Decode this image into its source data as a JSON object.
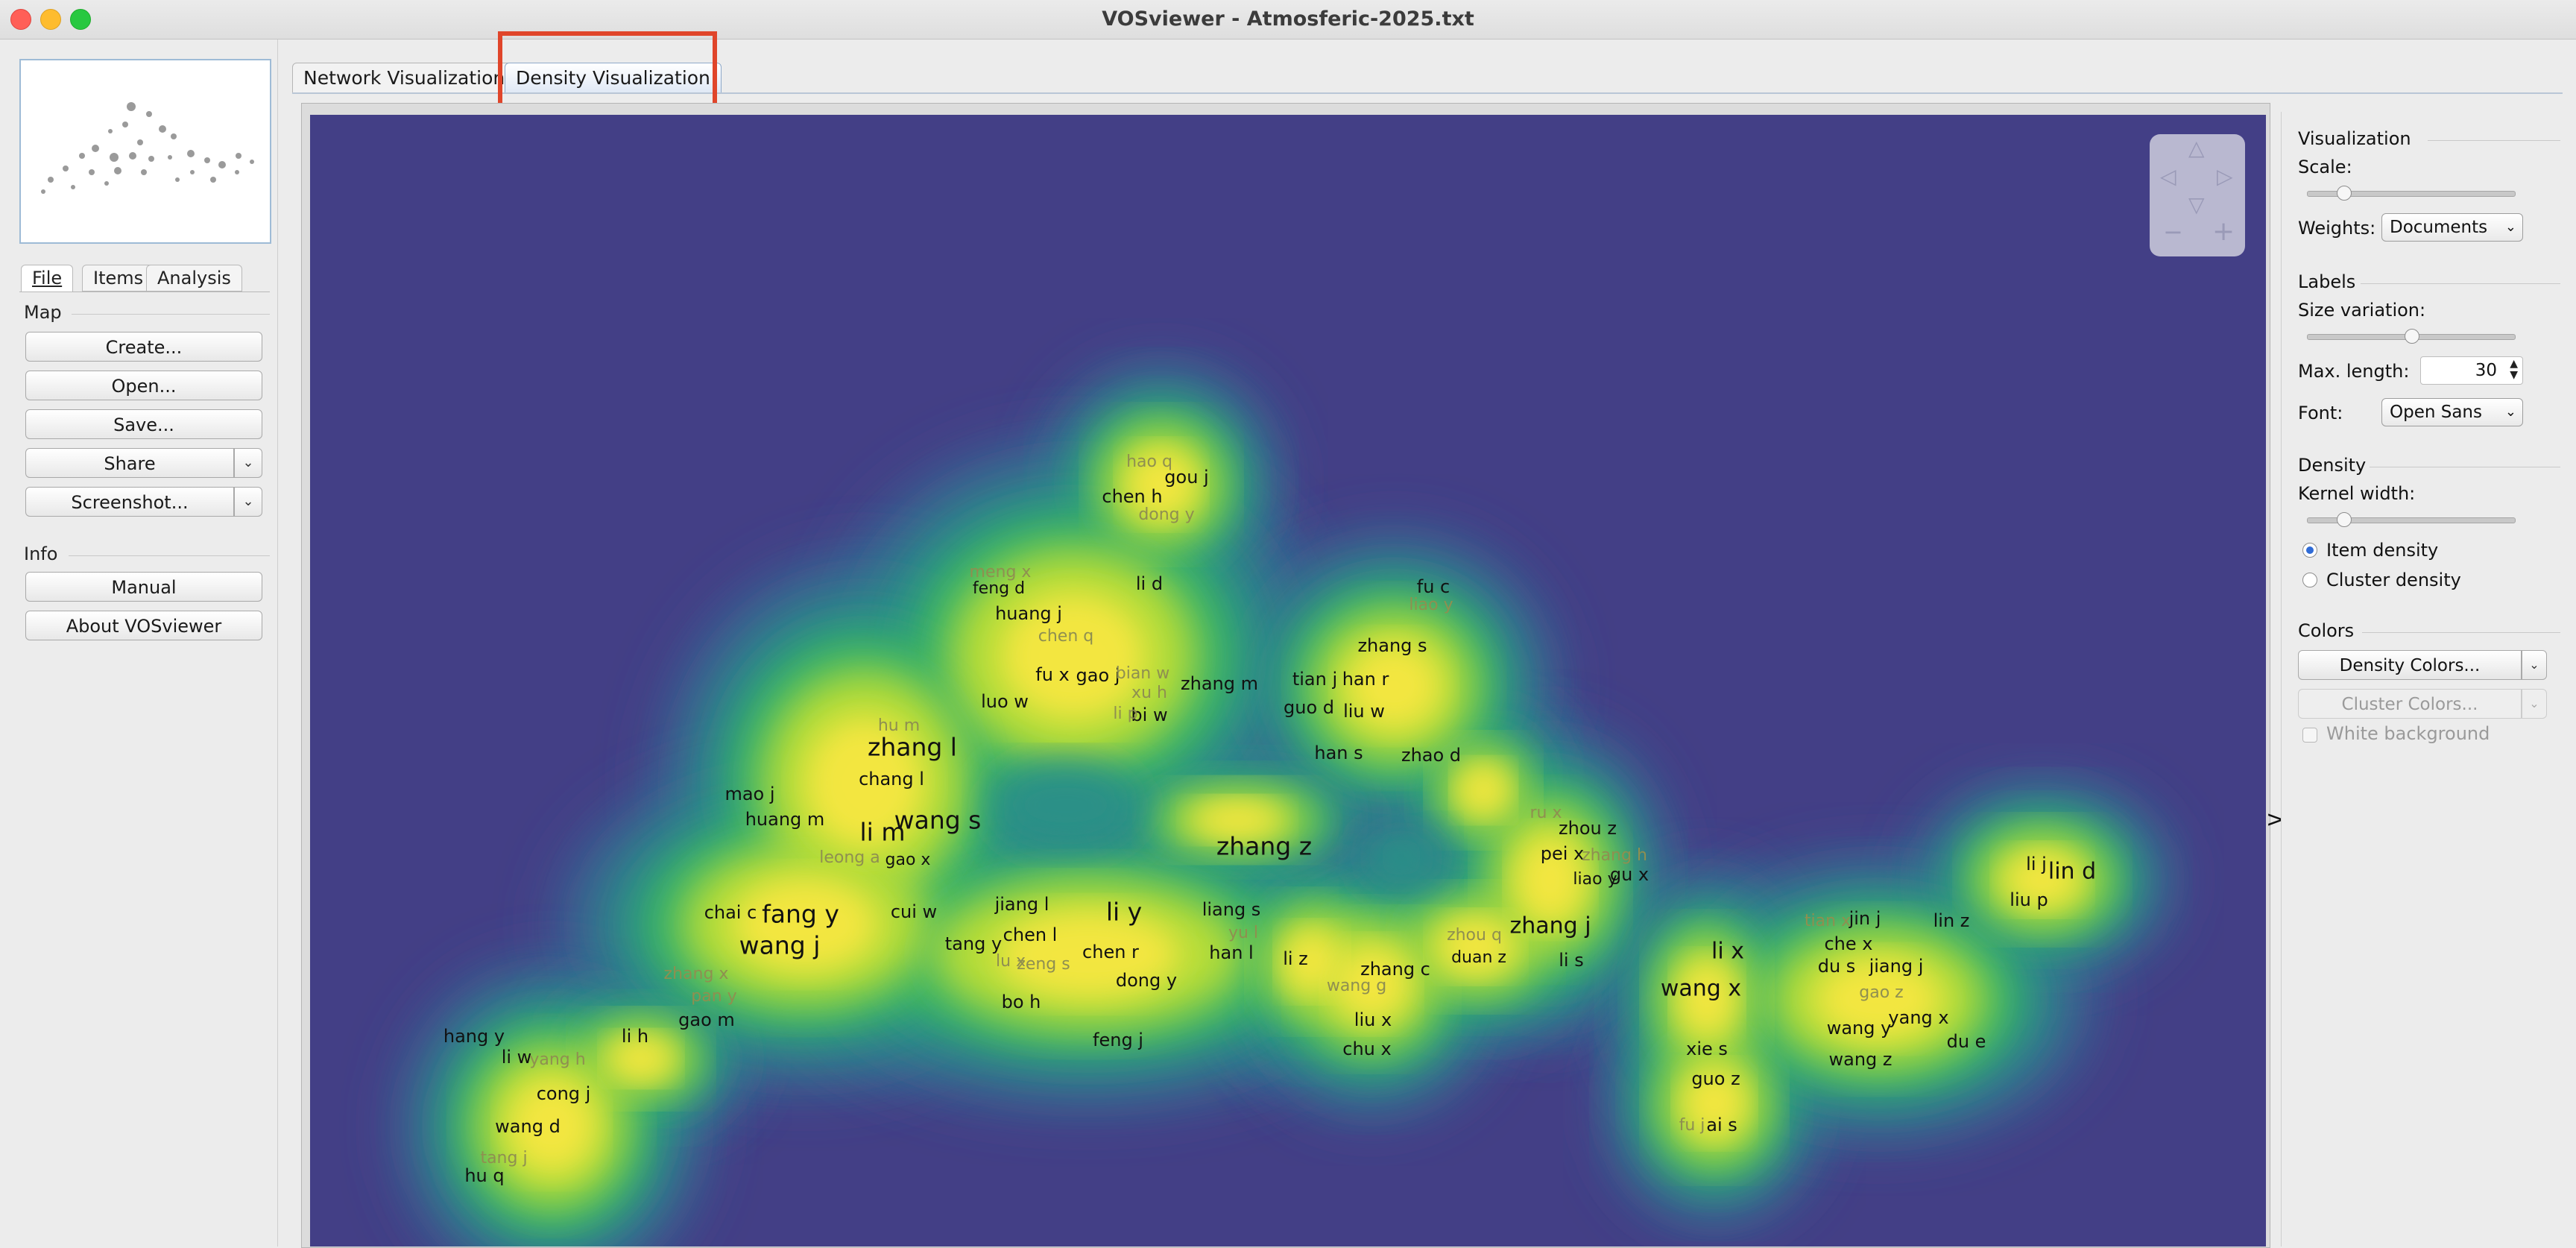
{
  "window": {
    "title": "VOSviewer - Atmosferic-2025.txt"
  },
  "left_panel": {
    "tabs": [
      "File",
      "Items",
      "Analysis"
    ],
    "map_section": "Map",
    "buttons": {
      "create": "Create...",
      "open": "Open...",
      "save": "Save...",
      "share": "Share",
      "screenshot": "Screenshot..."
    },
    "info_section": "Info",
    "info_buttons": {
      "manual": "Manual",
      "about": "About VOSviewer"
    }
  },
  "main_tabs": [
    "Network Visualization",
    "Density Visualization"
  ],
  "active_tab": "Density Visualization",
  "right_panel": {
    "visualization": {
      "header": "Visualization",
      "scale_label": "Scale:",
      "scale_value": 0.15,
      "weights_label": "Weights:",
      "weights_value": "Documents"
    },
    "labels": {
      "header": "Labels",
      "size_variation_label": "Size variation:",
      "size_variation_value": 0.5,
      "max_length_label": "Max. length:",
      "max_length_value": "30",
      "font_label": "Font:",
      "font_value": "Open Sans"
    },
    "density": {
      "header": "Density",
      "kernel_width_label": "Kernel width:",
      "kernel_width_value": 0.15,
      "item_density": "Item density",
      "cluster_density": "Cluster density",
      "selected": "Item density"
    },
    "colors": {
      "header": "Colors",
      "density_colors": "Density Colors...",
      "cluster_colors": "Cluster Colors...",
      "white_background": "White background"
    }
  },
  "density_map": {
    "colors": {
      "background": "#433f86",
      "blue": "#3a5f93",
      "teal": "#2a9087",
      "green": "#38b266",
      "lime": "#b6dd38",
      "yellow": "#f3e63f"
    },
    "items": [
      {
        "label": "hao q",
        "weight": 1,
        "faint": true
      },
      {
        "label": "gou j",
        "weight": 2
      },
      {
        "label": "chen h",
        "weight": 2
      },
      {
        "label": "dong y",
        "weight": 1,
        "faint": true
      },
      {
        "label": "li d",
        "weight": 2
      },
      {
        "label": "feng d",
        "weight": 1
      },
      {
        "label": "huang j",
        "weight": 2
      },
      {
        "label": "chen q",
        "weight": 1,
        "faint": true
      },
      {
        "label": "fu x",
        "weight": 2
      },
      {
        "label": "gao j",
        "weight": 2
      },
      {
        "label": "bian w",
        "weight": 1,
        "faint": true
      },
      {
        "label": "xu h",
        "weight": 1,
        "faint": true
      },
      {
        "label": "bi w",
        "weight": 2
      },
      {
        "label": "li p",
        "weight": 1,
        "faint": true
      },
      {
        "label": "luo w",
        "weight": 2
      },
      {
        "label": "zhang m",
        "weight": 2
      },
      {
        "label": "fu c",
        "weight": 2
      },
      {
        "label": "liao y",
        "weight": 1,
        "faint": true
      },
      {
        "label": "zhang s",
        "weight": 2
      },
      {
        "label": "tian j",
        "weight": 2
      },
      {
        "label": "han r",
        "weight": 2
      },
      {
        "label": "guo d",
        "weight": 2
      },
      {
        "label": "liu w",
        "weight": 2
      },
      {
        "label": "han s",
        "weight": 2
      },
      {
        "label": "zhao d",
        "weight": 2
      },
      {
        "label": "hu m",
        "weight": 1,
        "faint": true
      },
      {
        "label": "zhang l",
        "weight": 4
      },
      {
        "label": "chang l",
        "weight": 2
      },
      {
        "label": "mao j",
        "weight": 2
      },
      {
        "label": "huang m",
        "weight": 2
      },
      {
        "label": "wang s",
        "weight": 4
      },
      {
        "label": "li m",
        "weight": 4
      },
      {
        "label": "leong a",
        "weight": 1,
        "faint": true
      },
      {
        "label": "gao x",
        "weight": 1
      },
      {
        "label": "zhang z",
        "weight": 4
      },
      {
        "label": "ru x",
        "weight": 1,
        "faint": true
      },
      {
        "label": "zhou z",
        "weight": 2
      },
      {
        "label": "pei x",
        "weight": 2
      },
      {
        "label": "zhang h",
        "weight": 1,
        "faint": true
      },
      {
        "label": "liao y",
        "weight": 1
      },
      {
        "label": "gu x",
        "weight": 2
      },
      {
        "label": "li j",
        "weight": 2
      },
      {
        "label": "lin d",
        "weight": 3
      },
      {
        "label": "liu p",
        "weight": 2
      },
      {
        "label": "chai c",
        "weight": 2
      },
      {
        "label": "fang y",
        "weight": 4
      },
      {
        "label": "cui w",
        "weight": 2
      },
      {
        "label": "jiang l",
        "weight": 2
      },
      {
        "label": "li y",
        "weight": 4
      },
      {
        "label": "liang s",
        "weight": 2
      },
      {
        "label": "wang j",
        "weight": 4
      },
      {
        "label": "chen l",
        "weight": 2
      },
      {
        "label": "tang y",
        "weight": 2
      },
      {
        "label": "lu x",
        "weight": 1,
        "faint": true
      },
      {
        "label": "zeng s",
        "weight": 1,
        "faint": true
      },
      {
        "label": "chen r",
        "weight": 2
      },
      {
        "label": "yu l",
        "weight": 1,
        "faint": true
      },
      {
        "label": "han l",
        "weight": 2
      },
      {
        "label": "li z",
        "weight": 2
      },
      {
        "label": "zhang c",
        "weight": 2
      },
      {
        "label": "zhou q",
        "weight": 1,
        "faint": true
      },
      {
        "label": "duan z",
        "weight": 1
      },
      {
        "label": "zhang j",
        "weight": 3
      },
      {
        "label": "li s",
        "weight": 2
      },
      {
        "label": "li x",
        "weight": 3
      },
      {
        "label": "wang x",
        "weight": 3
      },
      {
        "label": "tian x",
        "weight": 1,
        "faint": true
      },
      {
        "label": "jin j",
        "weight": 2
      },
      {
        "label": "che x",
        "weight": 2
      },
      {
        "label": "du s",
        "weight": 2
      },
      {
        "label": "jiang j",
        "weight": 2
      },
      {
        "label": "gao z",
        "weight": 1,
        "faint": true
      },
      {
        "label": "lin z",
        "weight": 2
      },
      {
        "label": "wang y",
        "weight": 2
      },
      {
        "label": "yang x",
        "weight": 2
      },
      {
        "label": "du e",
        "weight": 2
      },
      {
        "label": "wang z",
        "weight": 2
      },
      {
        "label": "zhang x",
        "weight": 1,
        "faint": true
      },
      {
        "label": "pan y",
        "weight": 1,
        "faint": true
      },
      {
        "label": "gao m",
        "weight": 2
      },
      {
        "label": "dong y",
        "weight": 2
      },
      {
        "label": "bo h",
        "weight": 2
      },
      {
        "label": "feng j",
        "weight": 2
      },
      {
        "label": "wang g",
        "weight": 1,
        "faint": true
      },
      {
        "label": "liu x",
        "weight": 2
      },
      {
        "label": "chu x",
        "weight": 2
      },
      {
        "label": "xie s",
        "weight": 2
      },
      {
        "label": "guo z",
        "weight": 2
      },
      {
        "label": "fu j",
        "weight": 1,
        "faint": true
      },
      {
        "label": "ai s",
        "weight": 2
      },
      {
        "label": "hang y",
        "weight": 2
      },
      {
        "label": "li w",
        "weight": 2
      },
      {
        "label": "yang h",
        "weight": 1,
        "faint": true
      },
      {
        "label": "li h",
        "weight": 2
      },
      {
        "label": "cong j",
        "weight": 2
      },
      {
        "label": "wang d",
        "weight": 2
      },
      {
        "label": "tang j",
        "weight": 1,
        "faint": true
      },
      {
        "label": "hu q",
        "weight": 2
      },
      {
        "label": "meng x",
        "weight": 1,
        "faint": true
      }
    ]
  }
}
